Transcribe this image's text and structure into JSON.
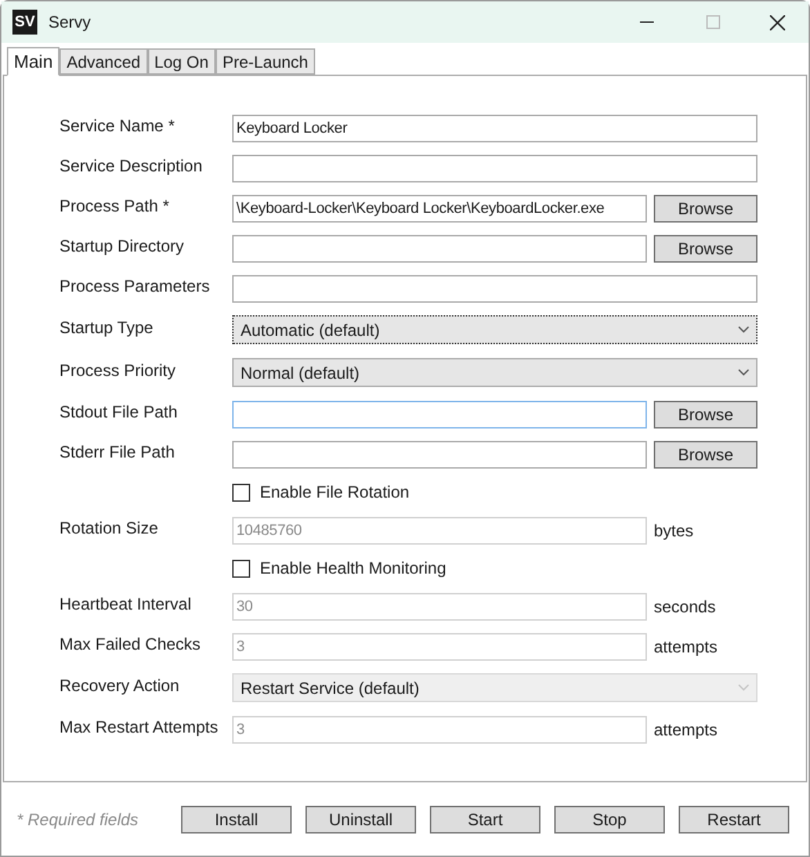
{
  "window": {
    "title": "Servy",
    "logo": "SV"
  },
  "tabs": [
    {
      "label": "Main",
      "selected": true
    },
    {
      "label": "Advanced",
      "selected": false
    },
    {
      "label": "Log On",
      "selected": false
    },
    {
      "label": "Pre-Launch",
      "selected": false
    }
  ],
  "rows": [
    {
      "kind": "text",
      "label": "Service Name *",
      "value": "Keyboard Locker",
      "disabled": false,
      "focused": false
    },
    {
      "kind": "text",
      "label": "Service Description",
      "disabled": false,
      "focused": false
    },
    {
      "kind": "browse",
      "label": "Process Path *",
      "value": "\\Keyboard-Locker\\Keyboard Locker\\KeyboardLocker.exe",
      "button": "Browse",
      "disabled": false,
      "focused": false
    },
    {
      "kind": "browse",
      "label": "Startup Directory",
      "button": "Browse",
      "disabled": false,
      "focused": false
    },
    {
      "kind": "text",
      "label": "Process Parameters",
      "disabled": false,
      "focused": false
    },
    {
      "kind": "select",
      "label": "Startup Type",
      "value": "Automatic (default)",
      "disabled": false,
      "focused": true
    },
    {
      "kind": "select",
      "label": "Process Priority",
      "value": "Normal (default)",
      "disabled": false,
      "focused": false
    },
    {
      "kind": "browse",
      "label": "Stdout File Path",
      "button": "Browse",
      "disabled": false,
      "focused": true
    },
    {
      "kind": "browse",
      "label": "Stderr File Path",
      "button": "Browse",
      "disabled": false,
      "focused": false
    },
    {
      "kind": "checkbox",
      "label": "Enable File Rotation",
      "checked": false
    },
    {
      "kind": "unit",
      "label": "Rotation Size",
      "value": "10485760",
      "unit": "bytes",
      "disabled": true,
      "focused": false
    },
    {
      "kind": "checkbox",
      "label": "Enable Health Monitoring",
      "checked": false
    },
    {
      "kind": "unit",
      "label": "Heartbeat Interval",
      "value": "30",
      "unit": "seconds",
      "disabled": true,
      "focused": false
    },
    {
      "kind": "unit",
      "label": "Max Failed Checks",
      "value": "3",
      "unit": "attempts",
      "disabled": true,
      "focused": false
    },
    {
      "kind": "select",
      "label": "Recovery Action",
      "value": "Restart Service (default)",
      "disabled": true,
      "focused": false
    },
    {
      "kind": "unit",
      "label": "Max Restart Attempts",
      "value": "3",
      "unit": "attempts",
      "disabled": true,
      "focused": false
    }
  ],
  "footer": {
    "note": "* Required fields",
    "buttons": [
      "Install",
      "Uninstall",
      "Start",
      "Stop",
      "Restart"
    ]
  }
}
